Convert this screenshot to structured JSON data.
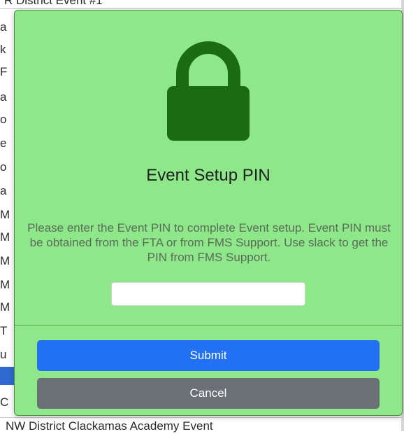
{
  "background": {
    "top_item": "R District Event #1",
    "bottom_item": "NW District Clackamas Academy Event",
    "side_fragments": [
      "a",
      "k",
      "F",
      "a",
      "o",
      "e",
      "o",
      "a",
      "M",
      "M",
      "M",
      "M",
      "M",
      "T",
      "u",
      "C"
    ]
  },
  "modal": {
    "icon": "lock-icon",
    "title": "Event Setup PIN",
    "message": "Please enter the Event PIN to complete Event setup. Event PIN must be obtained from the FTA or from FMS Support. Use slack to get the PIN from FMS Support.",
    "pin_value": "",
    "pin_placeholder": "",
    "submit_label": "Submit",
    "cancel_label": "Cancel"
  },
  "colors": {
    "modal_background": "#8ee88a",
    "lock_icon": "#1a6b12",
    "submit_button": "#2271f5",
    "cancel_button": "#6b7076"
  }
}
